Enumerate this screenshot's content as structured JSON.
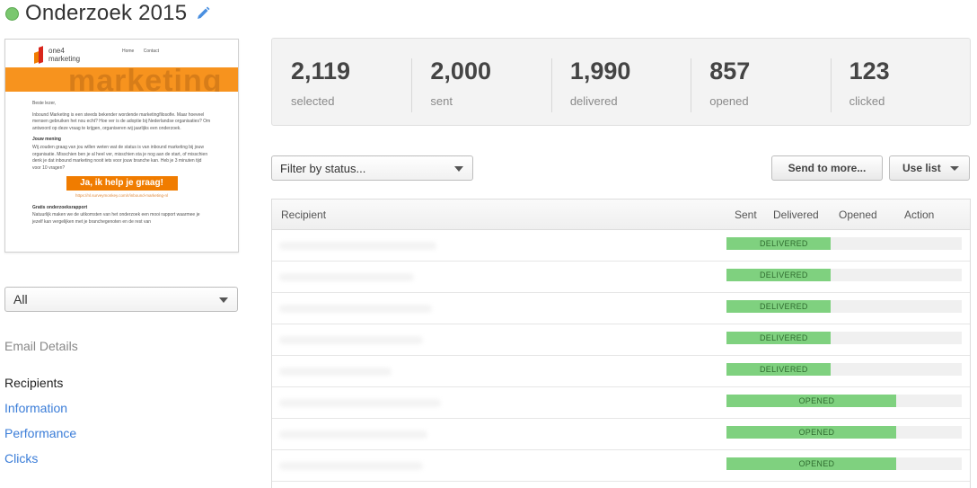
{
  "header": {
    "title": "Onderzoek 2015",
    "status_color": "#7ac76f",
    "edit_icon": "pencil-icon"
  },
  "email_preview": {
    "logo_line1": "one4",
    "logo_line2": "marketing",
    "nav": [
      "Home",
      "Contact"
    ],
    "banner_text": "marketing",
    "greeting": "Beste lezer,",
    "intro": "Inbound Marketing is een steeds bekender wordende marketingfilosofie. Maar hoeveel mensen gebruiken het nou echt? Hoe ver is de adoptie bij Nederlandse organisaties? Om antwoord op deze vraag te krijgen, organiseren wij jaarlijks een onderzoek.",
    "section1_title": "Jouw mening",
    "section1_text": "Wij zouden graag van jou willen weten wat de status is van inbound marketing bij jouw organisatie. Misschien ben je al heel ver, misschien sta je nog aan de start, of misschien denk je dat inbound marketing nooit iets voor jouw branche kan. Heb je 3 minuten tijd voor 10 vragen?",
    "cta_label": "Ja, ik help je graag!",
    "cta_link": "https://nl.surveymonkey.com/r/inbound-marketing-nl",
    "section2_title": "Gratis onderzoeksrapport",
    "section2_text": "Natuurlijk maken we de uitkomsten van het onderzoek een mooi rapport waarmee je jezelf kan vergelijken met je branchegenoten en de rest van"
  },
  "sidebar": {
    "select_value": "All",
    "heading": "Email Details",
    "items": [
      {
        "label": "Recipients",
        "active": true
      },
      {
        "label": "Information",
        "active": false
      },
      {
        "label": "Performance",
        "active": false
      },
      {
        "label": "Clicks",
        "active": false
      }
    ]
  },
  "stats": [
    {
      "value": "2,119",
      "label": "selected"
    },
    {
      "value": "2,000",
      "label": "sent"
    },
    {
      "value": "1,990",
      "label": "delivered"
    },
    {
      "value": "857",
      "label": "opened"
    },
    {
      "value": "123",
      "label": "clicked"
    }
  ],
  "toolbar": {
    "filter_placeholder": "Filter by status...",
    "send_more_label": "Send to more...",
    "use_list_label": "Use list"
  },
  "table": {
    "columns": [
      "Recipient",
      "Sent",
      "Delivered",
      "Opened",
      "Action"
    ],
    "colors": {
      "bar": "#7fd17f",
      "track": "#f0f0f0"
    },
    "rows": [
      {
        "status": "DELIVERED",
        "progress_stage": 2
      },
      {
        "status": "DELIVERED",
        "progress_stage": 2
      },
      {
        "status": "DELIVERED",
        "progress_stage": 2
      },
      {
        "status": "DELIVERED",
        "progress_stage": 2
      },
      {
        "status": "DELIVERED",
        "progress_stage": 2
      },
      {
        "status": "OPENED",
        "progress_stage": 3
      },
      {
        "status": "OPENED",
        "progress_stage": 3
      },
      {
        "status": "OPENED",
        "progress_stage": 3
      }
    ]
  }
}
